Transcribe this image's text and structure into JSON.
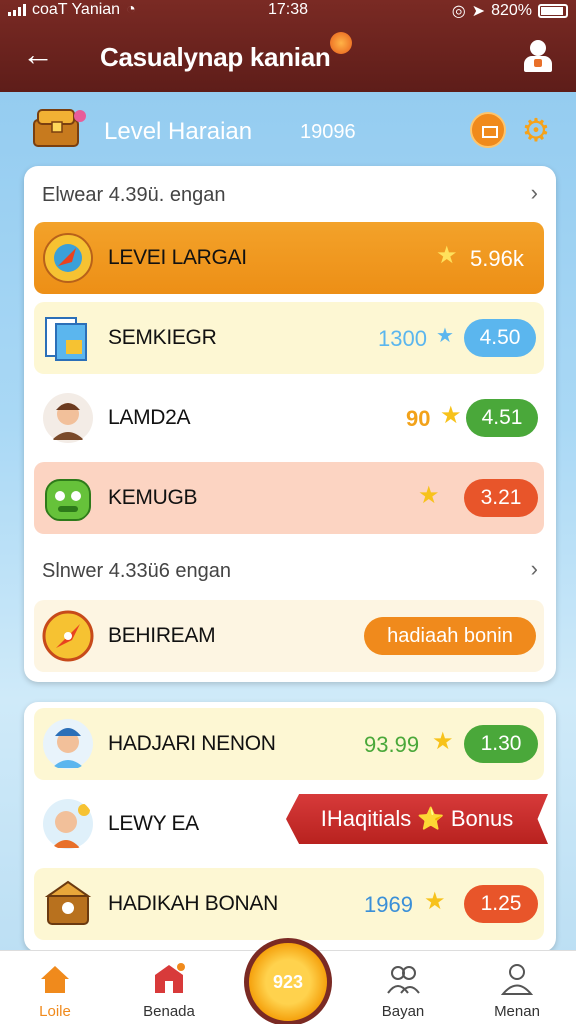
{
  "status_bar": {
    "carrier": "coaT Yanian",
    "time": "17:38",
    "battery": "820%"
  },
  "header": {
    "title": "Casualynap kanian"
  },
  "level": {
    "label": "Level Haraian",
    "value": "19096"
  },
  "section1": {
    "title": "Elwear 4.39ü. engan"
  },
  "section2": {
    "title": "Slnwer 4.33ü6 engan"
  },
  "rows1": [
    {
      "name": "LEVEI LARGAI",
      "score": "5.96k"
    },
    {
      "name": "SEMKIEGR",
      "score": "1300",
      "value": "4.50"
    },
    {
      "name": "LAMD2A",
      "score": "90",
      "value": "4.51"
    },
    {
      "name": "KEMUGB",
      "value": "3.21"
    }
  ],
  "row_special": {
    "name": "BEHIREAM",
    "pill": "hadiaah bonin"
  },
  "rows2": [
    {
      "name": "HADJARI NENON",
      "score": "93.99",
      "value": "1.30"
    },
    {
      "name": "LEWY EA",
      "ribbon": "IHaqitials ⭐ Bonus"
    },
    {
      "name": "HADIKAH BONAN",
      "score": "1969",
      "value": "1.25"
    }
  ],
  "center_button": {
    "label": "923"
  },
  "nav": {
    "home": "Loile",
    "shop": "Benada",
    "friends": "Bayan",
    "profile": "Menan"
  },
  "colors": {
    "primary": "#7a2a24",
    "accent": "#f08a1c",
    "star": "#f7c21b",
    "blue": "#5bb6ee",
    "green": "#4aa83a",
    "red": "#e8552a"
  }
}
